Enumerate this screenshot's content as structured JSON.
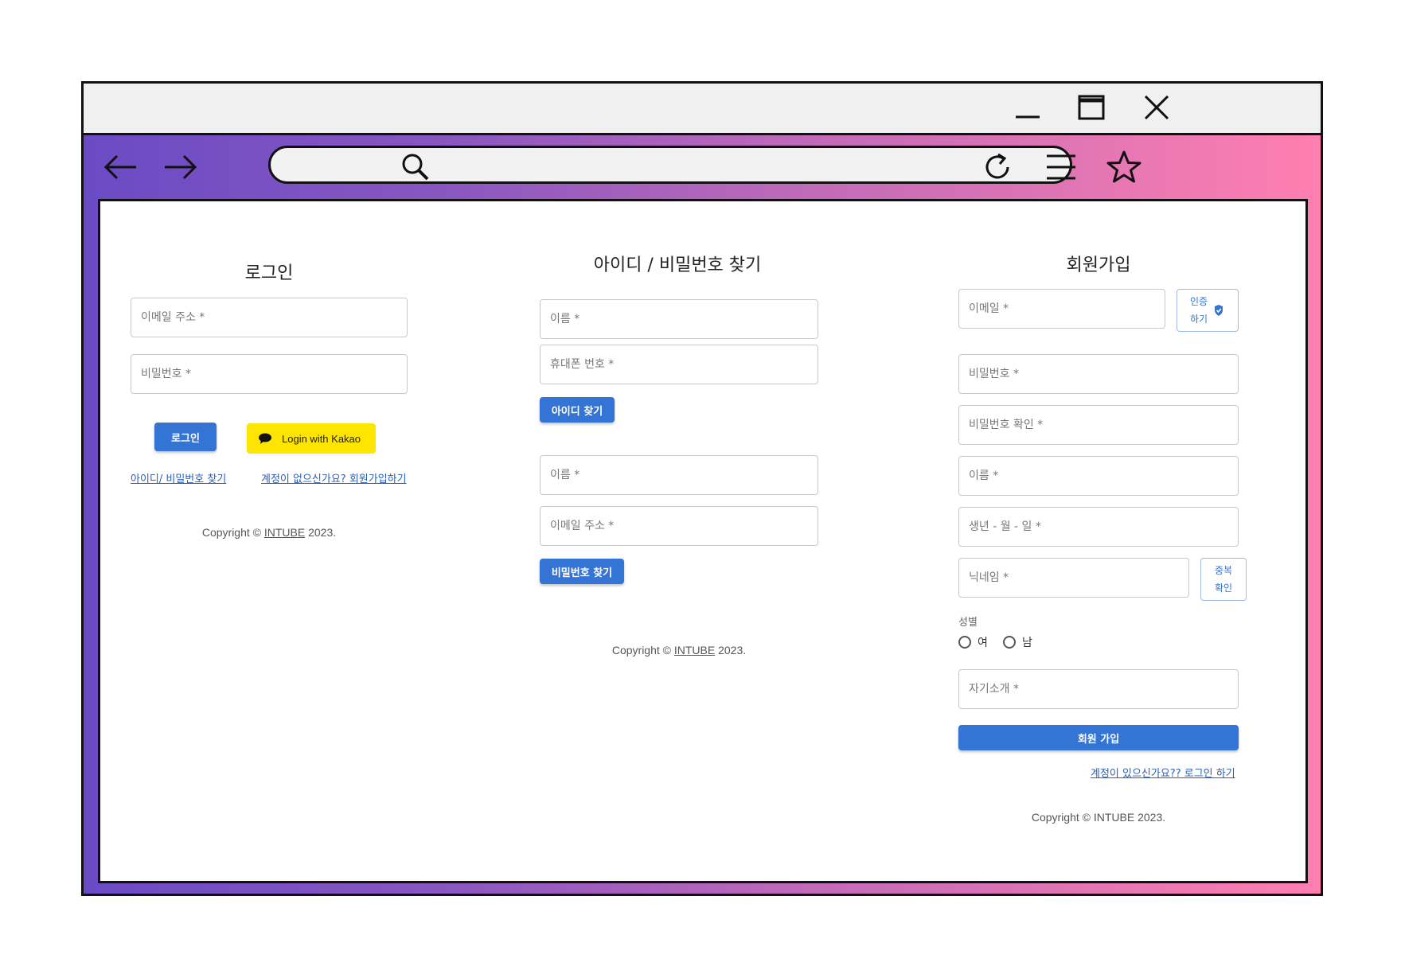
{
  "login": {
    "title": "로그인",
    "email_placeholder": "이메일 주소 *",
    "password_placeholder": "비밀번호 *",
    "login_button": "로그인",
    "kakao_button": "Login with Kakao",
    "find_link": "아이디/ 비밀번호 찾기",
    "signup_link": "계정이 없으신가요? 회원가입하기",
    "copyright_prefix": "Copyright © ",
    "copyright_brand": "INTUBE",
    "copyright_suffix": " 2023."
  },
  "find": {
    "title": "아이디 / 비밀번호 찾기",
    "id_name_placeholder": "이름 *",
    "id_phone_placeholder": "휴대폰 번호 *",
    "find_id_button": "아이디 찾기",
    "pw_name_placeholder": "이름 *",
    "pw_email_placeholder": "이메일 주소 *",
    "find_pw_button": "비밀번호 찾기",
    "copyright_prefix": "Copyright © ",
    "copyright_brand": "INTUBE",
    "copyright_suffix": " 2023."
  },
  "signup": {
    "title": "회원가입",
    "email_placeholder": "이메일 *",
    "verify_button_line1": "인증",
    "verify_button_line2": "하기",
    "password_placeholder": "비밀번호 *",
    "password_confirm_placeholder": "비밀번호 확인 *",
    "name_placeholder": "이름 *",
    "birth_placeholder": "생년 - 월 - 일 *",
    "nickname_placeholder": "닉네임 *",
    "dup_check_line1": "중복",
    "dup_check_line2": "확인",
    "gender_label": "성별",
    "gender_female": "여",
    "gender_male": "남",
    "intro_placeholder": "자기소개 *",
    "signup_button": "회원 가입",
    "login_link": "계정이 있으신가요?? 로그인 하기",
    "copyright_prefix": "Copyright © ",
    "copyright_brand": "INTUBE",
    "copyright_suffix": " 2023."
  },
  "icons": {
    "browser": [
      "minimize-icon",
      "maximize-icon",
      "close-icon",
      "back-arrow-icon",
      "forward-arrow-icon",
      "search-icon",
      "refresh-icon",
      "menu-icon",
      "star-icon"
    ],
    "kakao": "chat-bubble-icon",
    "verify": "check-badge-icon"
  },
  "colors": {
    "primary": "#3474d4",
    "kakao": "#fee500",
    "gradient_start": "#6a4bc4",
    "gradient_end": "#ff7fb0"
  }
}
